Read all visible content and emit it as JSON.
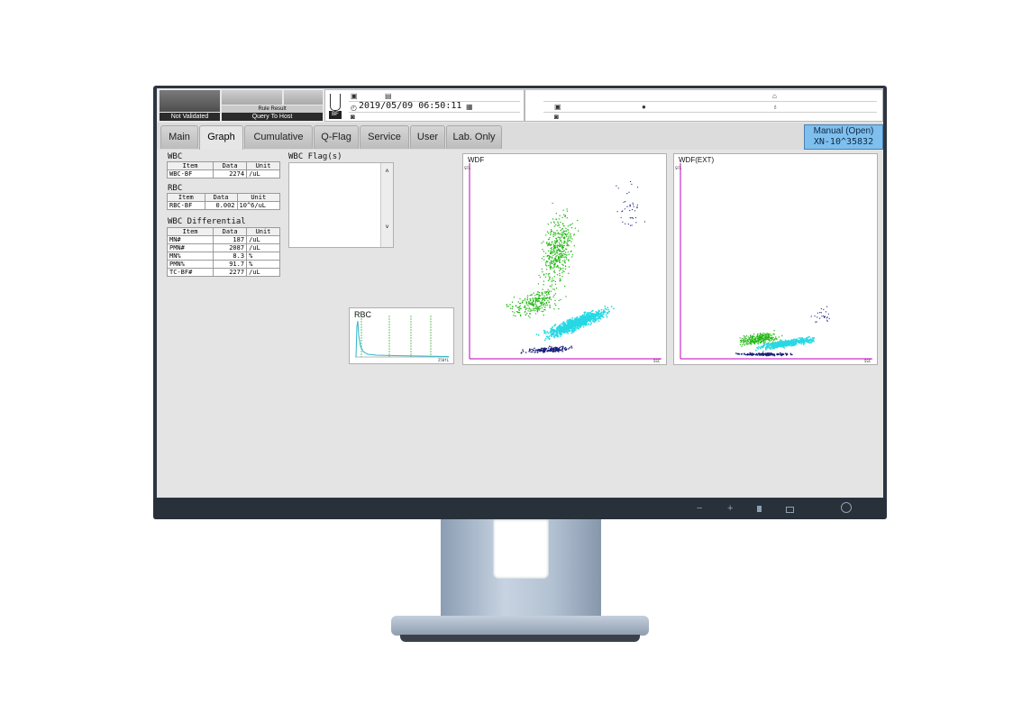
{
  "header": {
    "status_label": "Not Validated",
    "rule_result_label": "Rule Result",
    "query_label": "Query To Host",
    "sample_badge": "BF",
    "datetime": "2019/05/09 06:50:11"
  },
  "tabs": [
    {
      "label": "Main"
    },
    {
      "label": "Graph"
    },
    {
      "label": "Cumulative"
    },
    {
      "label": "Q-Flag"
    },
    {
      "label": "Service"
    },
    {
      "label": "User"
    },
    {
      "label": "Lab. Only"
    }
  ],
  "mode": {
    "line1": "Manual (Open)",
    "line2": "XN-10^35832"
  },
  "wbc": {
    "title": "WBC",
    "headers": [
      "Item",
      "Data",
      "Unit"
    ],
    "rows": [
      {
        "item": "WBC-BF",
        "data": "2274",
        "unit": "/uL"
      }
    ]
  },
  "rbc": {
    "title": "RBC",
    "headers": [
      "Item",
      "Data",
      "Unit"
    ],
    "rows": [
      {
        "item": "RBC-BF",
        "data": "0.002",
        "unit": "10^6/uL"
      }
    ]
  },
  "diff": {
    "title": "WBC Differential",
    "headers": [
      "Item",
      "Data",
      "Unit"
    ],
    "rows": [
      {
        "item": "MN#",
        "data": "187",
        "unit": "/uL"
      },
      {
        "item": "PMN#",
        "data": "2087",
        "unit": "/uL"
      },
      {
        "item": "MN%",
        "data": "8.3",
        "unit": "%"
      },
      {
        "item": "PMN%",
        "data": "91.7",
        "unit": "%"
      },
      {
        "item": "TC-BF#",
        "data": "2277",
        "unit": "/uL"
      }
    ]
  },
  "flags": {
    "title": "WBC Flag(s)",
    "scroll_up": "˄",
    "scroll_down": "˅"
  },
  "rbc_hist": {
    "title": "RBC",
    "axis_max": "250fL"
  },
  "wdf": {
    "title": "WDF",
    "ylabel": "SFL",
    "xlabel": "SSC"
  },
  "wdf_ext": {
    "title": "WDF(EXT)",
    "ylabel": "SFL",
    "xlabel": "SSC"
  },
  "colors": {
    "lymph": "#22b814",
    "neut": "#27d8e4",
    "debris": "#1a1f7a",
    "axis": "#c000c0",
    "mode_bg": "#7fbfee"
  },
  "controls": {
    "minus": "−",
    "plus": "+"
  }
}
